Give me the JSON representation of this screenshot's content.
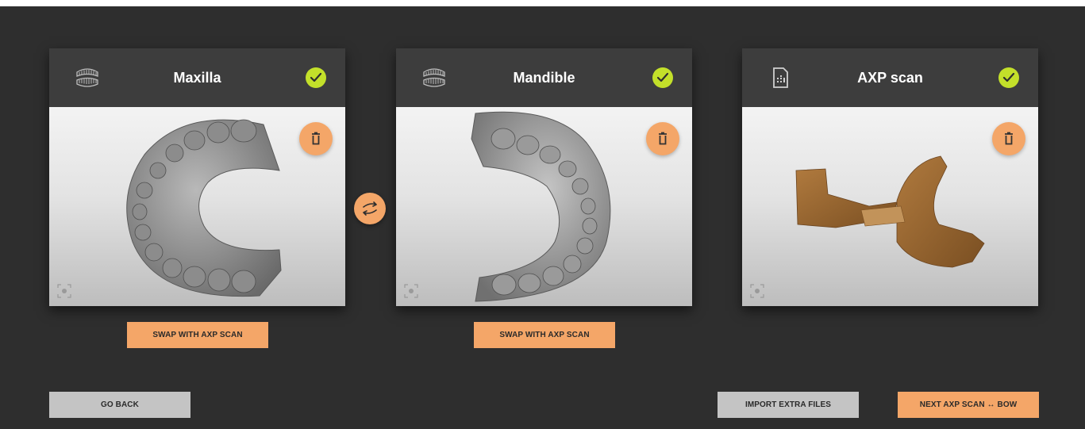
{
  "cards": [
    {
      "title": "Maxilla",
      "icon": "teeth-arch-icon",
      "status": "complete",
      "delete_icon": "trash-icon",
      "focus_icon": "focus-icon",
      "swap_label": "SWAP WITH AXP SCAN",
      "scan_color": "#9a9a9a"
    },
    {
      "title": "Mandible",
      "icon": "teeth-arch-icon",
      "status": "complete",
      "delete_icon": "trash-icon",
      "focus_icon": "focus-icon",
      "swap_label": "SWAP WITH AXP SCAN",
      "scan_color": "#a0a0a0"
    },
    {
      "title": "AXP scan",
      "icon": "sim-card-icon",
      "status": "complete",
      "delete_icon": "trash-icon",
      "focus_icon": "focus-icon",
      "scan_color": "#a0703a"
    }
  ],
  "swap_jaws_icon": "swap-arrows-icon",
  "footer": {
    "go_back": "GO BACK",
    "import_extra": "IMPORT EXTRA FILES",
    "next": "NEXT AXP SCAN ↔ BOW"
  },
  "colors": {
    "accent": "#f4a668",
    "check": "#c3e02a",
    "background": "#2e2e2e",
    "header": "#3d3d3d",
    "secondary_button": "#c4c4c4"
  }
}
